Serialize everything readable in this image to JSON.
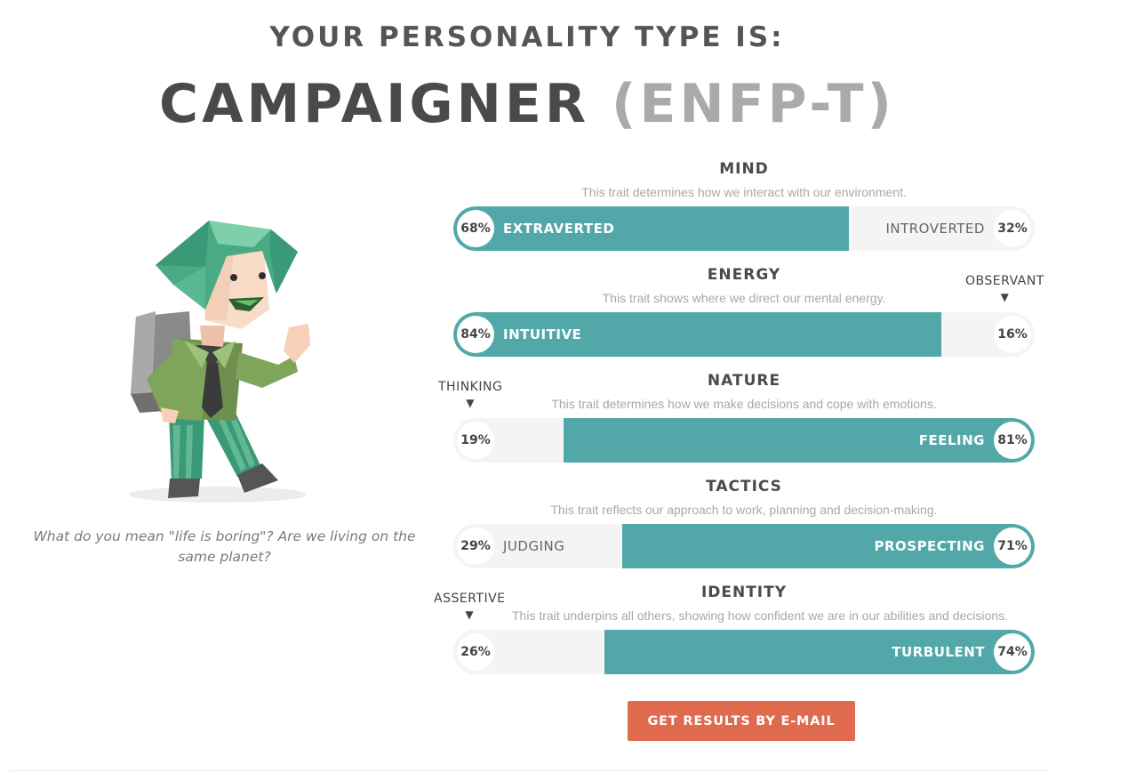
{
  "header": {
    "subtitle": "YOUR PERSONALITY TYPE IS:",
    "type_name": "CAMPAIGNER",
    "type_code": "(ENFP-T)"
  },
  "character": {
    "quote": "What do you mean \"life is boring\"? Are we living on the same planet?"
  },
  "traits": [
    {
      "name": "MIND",
      "description": "This trait determines how we interact with our environment.",
      "left_percent": "68%",
      "left_label": "EXTRAVERTED",
      "right_percent": "32%",
      "right_label": "INTROVERTED",
      "dominant_side": "left",
      "dominant_fraction": 0.68
    },
    {
      "name": "ENERGY",
      "description": "This trait shows where we direct our mental energy.",
      "left_percent": "84%",
      "left_label": "INTUITIVE",
      "right_percent": "16%",
      "marker": "OBSERVANT",
      "dominant_side": "left",
      "dominant_fraction": 0.84
    },
    {
      "name": "NATURE",
      "description": "This trait determines how we make decisions and cope with emotions.",
      "left_percent": "19%",
      "right_percent": "81%",
      "right_label": "FEELING",
      "marker": "THINKING",
      "dominant_side": "right",
      "dominant_fraction": 0.81
    },
    {
      "name": "TACTICS",
      "description": "This trait reflects our approach to work, planning and decision-making.",
      "left_percent": "29%",
      "left_label": "JUDGING",
      "right_percent": "71%",
      "right_label": "PROSPECTING",
      "dominant_side": "right",
      "dominant_fraction": 0.71
    },
    {
      "name": "IDENTITY",
      "description": "This trait underpins all others, showing how confident we are in our abilities and decisions.",
      "left_percent": "26%",
      "right_percent": "74%",
      "right_label": "TURBULENT",
      "marker": "ASSERTIVE",
      "dominant_side": "right",
      "dominant_fraction": 0.74
    }
  ],
  "actions": {
    "email_button": "GET RESULTS BY E-MAIL"
  },
  "colors": {
    "accent_teal": "#52a8a8",
    "button_orange": "#df6a4e",
    "track_gray": "#f4f4f4"
  }
}
